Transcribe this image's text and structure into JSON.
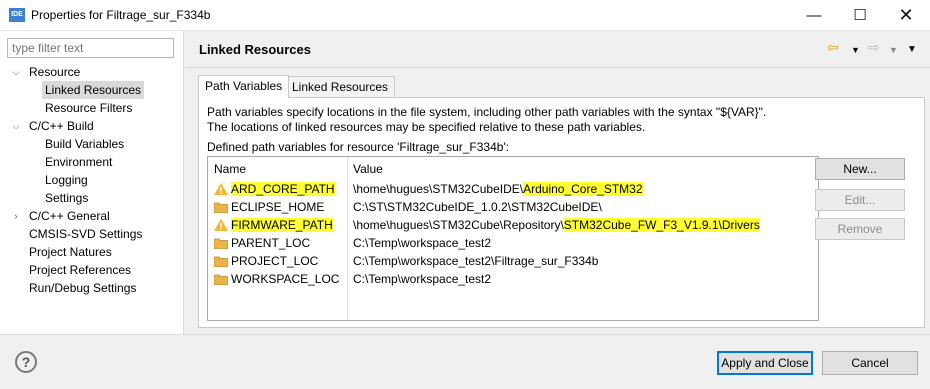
{
  "window": {
    "app_icon": "IDE",
    "title": "Properties for Filtrage_sur_F334b",
    "minimize": "—",
    "maximize": "☐",
    "close": "✕"
  },
  "left": {
    "filter_placeholder": "type filter text",
    "tree": [
      {
        "label": "Resource",
        "expanded": true
      },
      {
        "label": "Linked Resources",
        "selected": true
      },
      {
        "label": "Resource Filters"
      },
      {
        "label": "C/C++ Build",
        "expanded": true
      },
      {
        "label": "Build Variables"
      },
      {
        "label": "Environment"
      },
      {
        "label": "Logging"
      },
      {
        "label": "Settings"
      },
      {
        "label": "C/C++ General",
        "expanded": false
      },
      {
        "label": "CMSIS-SVD Settings"
      },
      {
        "label": "Project Natures"
      },
      {
        "label": "Project References"
      },
      {
        "label": "Run/Debug Settings"
      }
    ]
  },
  "page": {
    "title": "Linked Resources",
    "tabs": [
      {
        "label": "Path Variables",
        "active": true
      },
      {
        "label": "Linked Resources",
        "active": false
      }
    ],
    "description_line1": "Path variables specify locations in the file system, including other path variables with the syntax \"${VAR}\".",
    "description_line2": "The locations of linked resources may be specified relative to these path variables.",
    "defined_label": "Defined path variables for resource 'Filtrage_sur_F334b':",
    "table": {
      "headers": {
        "name": "Name",
        "value": "Value"
      },
      "rows": [
        {
          "icon": "warning-icon",
          "name": "ARD_CORE_PATH",
          "value_prefix": "\\home\\hugues\\STM32CubeIDE\\",
          "value_highlight": "Arduino_Core_STM32",
          "name_highlighted": true
        },
        {
          "icon": "folder-icon",
          "name": "ECLIPSE_HOME",
          "value_prefix": "C:\\ST\\STM32CubeIDE_1.0.2\\STM32CubeIDE\\",
          "value_highlight": "",
          "name_highlighted": false
        },
        {
          "icon": "warning-icon",
          "name": "FIRMWARE_PATH",
          "value_prefix": "\\home\\hugues\\STM32Cube\\Repository\\",
          "value_highlight": "STM32Cube_FW_F3_V1.9.1\\Drivers",
          "name_highlighted": true
        },
        {
          "icon": "folder-icon",
          "name": "PARENT_LOC",
          "value_prefix": "C:\\Temp\\workspace_test2",
          "value_highlight": "",
          "name_highlighted": false
        },
        {
          "icon": "folder-icon",
          "name": "PROJECT_LOC",
          "value_prefix": "C:\\Temp\\workspace_test2\\Filtrage_sur_F334b",
          "value_highlight": "",
          "name_highlighted": false
        },
        {
          "icon": "folder-icon",
          "name": "WORKSPACE_LOC",
          "value_prefix": "C:\\Temp\\workspace_test2",
          "value_highlight": "",
          "name_highlighted": false
        }
      ]
    },
    "buttons": {
      "new": "New...",
      "edit": "Edit...",
      "remove": "Remove"
    }
  },
  "footer": {
    "help": "?",
    "apply_close": "Apply and Close",
    "cancel": "Cancel"
  },
  "colors": {
    "highlight": "#ffff32",
    "warning": "#f2b632",
    "folder": "#e8b54a",
    "primary_border": "#0078d7"
  }
}
